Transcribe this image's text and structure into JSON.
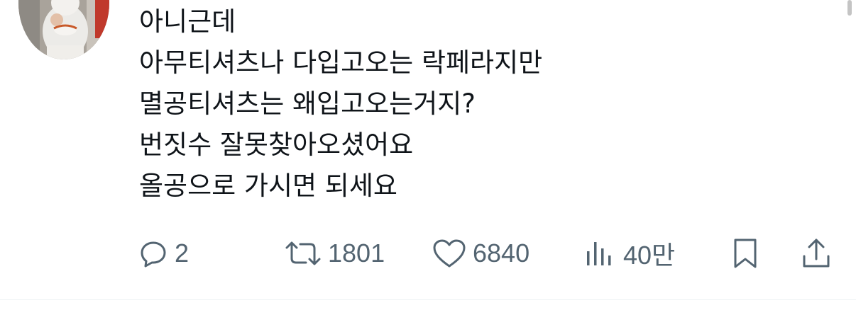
{
  "post": {
    "lines": [
      "아니근데",
      "아무티셔츠나 다입고오는 락페라지만",
      "멸공티셔츠는 왜입고오는거지?",
      "번짓수 잘못찾아오셨어요",
      "올공으로 가시면 되세요"
    ]
  },
  "actions": {
    "reply": {
      "icon": "reply-icon",
      "count": "2"
    },
    "repost": {
      "icon": "repost-icon",
      "count": "1801"
    },
    "like": {
      "icon": "heart-icon",
      "count": "6840"
    },
    "views": {
      "icon": "views-chart-icon",
      "count": "40만"
    },
    "bookmark": {
      "icon": "bookmark-icon"
    },
    "share": {
      "icon": "share-icon"
    }
  },
  "colors": {
    "text": "#0f1419",
    "muted": "#536471",
    "background": "#ffffff"
  }
}
